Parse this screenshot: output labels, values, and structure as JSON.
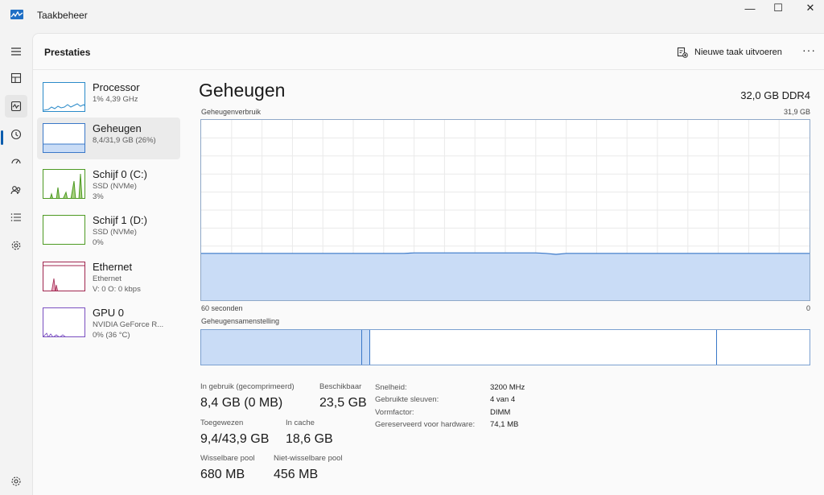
{
  "window": {
    "title": "Taakbeheer",
    "minimize_glyph": "—",
    "maximize_glyph": "☐",
    "close_glyph": "✕"
  },
  "header": {
    "page_title": "Prestaties",
    "new_task_label": "Nieuwe taak uitvoeren",
    "more_glyph": "···"
  },
  "nav": {
    "icons": [
      "hamburger-icon",
      "processes-icon",
      "performance-icon",
      "app-history-icon",
      "startup-apps-icon",
      "users-icon",
      "details-icon",
      "services-icon",
      "settings-icon"
    ],
    "active": "performance-icon"
  },
  "devices": [
    {
      "name": "Processor",
      "line1": "1% 4,39 GHz",
      "line2": "",
      "color": "#2a8ac9",
      "active": false
    },
    {
      "name": "Geheugen",
      "line1": "8,4/31,9 GB (26%)",
      "line2": "",
      "color": "#3a78c8",
      "active": true
    },
    {
      "name": "Schijf 0 (C:)",
      "line1": "SSD (NVMe)",
      "line2": "3%",
      "color": "#4d9a22",
      "active": false
    },
    {
      "name": "Schijf 1 (D:)",
      "line1": "SSD (NVMe)",
      "line2": "0%",
      "color": "#4d9a22",
      "active": false
    },
    {
      "name": "Ethernet",
      "line1": "Ethernet",
      "line2": "V: 0 O: 0 kbps",
      "color": "#a0264f",
      "active": false
    },
    {
      "name": "GPU 0",
      "line1": "NVIDIA GeForce R...",
      "line2": "0% (36 °C)",
      "color": "#7a4fc0",
      "active": false
    }
  ],
  "main": {
    "title": "Geheugen",
    "spec": "32,0 GB DDR4",
    "usage_label": "Geheugenverbruik",
    "usage_max": "31,9 GB",
    "time_left": "60 seconden",
    "time_right": "0",
    "usage_fraction": 0.26,
    "composition_label": "Geheugensamenstelling",
    "composition": {
      "in_use_fraction": 0.265,
      "modified_fraction": 0.013,
      "standby_fraction": 0.57,
      "free_fraction": 0.152
    },
    "accent": "#3a78c8",
    "fill": "#c9dcf6"
  },
  "stats": {
    "in_use": {
      "label": "In gebruik (gecomprimeerd)",
      "value": "8,4 GB (0 MB)"
    },
    "available": {
      "label": "Beschikbaar",
      "value": "23,5 GB"
    },
    "committed": {
      "label": "Toegewezen",
      "value": "9,4/43,9 GB"
    },
    "cached": {
      "label": "In cache",
      "value": "18,6 GB"
    },
    "paged_pool": {
      "label": "Wisselbare pool",
      "value": "680 MB"
    },
    "nonpaged_pool": {
      "label": "Niet-wisselbare pool",
      "value": "456 MB"
    }
  },
  "specs": [
    {
      "key": "Snelheid:",
      "value": "3200 MHz"
    },
    {
      "key": "Gebruikte sleuven:",
      "value": "4 van 4"
    },
    {
      "key": "Vormfactor:",
      "value": "DIMM"
    },
    {
      "key": "Gereserveerd voor hardware:",
      "value": "74,1 MB"
    }
  ]
}
